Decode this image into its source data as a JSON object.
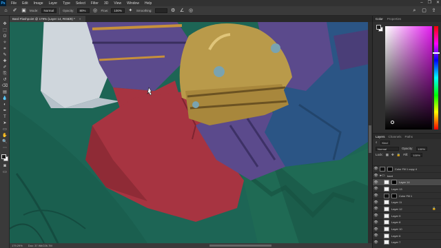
{
  "menubar": {
    "logo": "Ps",
    "items": [
      "File",
      "Edit",
      "Image",
      "Layer",
      "Type",
      "Select",
      "Filter",
      "3D",
      "View",
      "Window",
      "Help"
    ],
    "window_controls": [
      "–",
      "❐",
      "✕"
    ]
  },
  "options": {
    "mode_label": "Mode:",
    "mode_value": "Normal",
    "opacity_label": "Opacity:",
    "opacity_value": "80%",
    "flow_label": "Flow:",
    "flow_value": "100%",
    "smoothing_label": "Smoothing:",
    "smoothing_value": ""
  },
  "document": {
    "tab_title": "Bard Flashpoint @ 179% (Layer 14, RGB/8) *",
    "close_glyph": "×"
  },
  "status": {
    "zoom": "179.29%",
    "doc_size": "Doc: 37.9M/226.7M"
  },
  "color_panel": {
    "tabs": [
      "Color",
      "Properties"
    ]
  },
  "layers_panel": {
    "tabs": [
      "Layers",
      "Channels",
      "Paths"
    ],
    "filter_label": "Kind",
    "blend_mode": "Normal",
    "opacity_label": "Opacity:",
    "opacity_value": "100%",
    "lock_label": "Lock:",
    "fill_label": "Fill:",
    "fill_value": "100%",
    "layers": [
      {
        "name": "Color Fill 1 copy 4",
        "thumb": "dark",
        "mask": true,
        "selected": false,
        "indent": false,
        "folder": false,
        "locked": false
      },
      {
        "name": "bard",
        "thumb": "folder",
        "mask": false,
        "selected": false,
        "indent": false,
        "folder": true,
        "locked": false
      },
      {
        "name": "Layer 14",
        "thumb": "light",
        "mask": true,
        "selected": true,
        "indent": true,
        "folder": false,
        "locked": false
      },
      {
        "name": "Layer 13",
        "thumb": "light",
        "mask": false,
        "selected": false,
        "indent": true,
        "folder": false,
        "locked": false
      },
      {
        "name": "Color Fill 1",
        "thumb": "dark",
        "mask": true,
        "selected": false,
        "indent": true,
        "folder": false,
        "locked": false
      },
      {
        "name": "Layer 11",
        "thumb": "light",
        "mask": false,
        "selected": false,
        "indent": true,
        "folder": false,
        "locked": false
      },
      {
        "name": "Layer 12",
        "thumb": "light",
        "mask": false,
        "selected": false,
        "indent": true,
        "folder": false,
        "locked": true
      },
      {
        "name": "Layer 9",
        "thumb": "light",
        "mask": false,
        "selected": false,
        "indent": true,
        "folder": false,
        "locked": false
      },
      {
        "name": "Layer 8",
        "thumb": "light",
        "mask": false,
        "selected": false,
        "indent": true,
        "folder": false,
        "locked": false
      },
      {
        "name": "Layer 10",
        "thumb": "light",
        "mask": false,
        "selected": false,
        "indent": true,
        "folder": false,
        "locked": false
      },
      {
        "name": "Layer 6",
        "thumb": "light",
        "mask": false,
        "selected": false,
        "indent": true,
        "folder": false,
        "locked": false
      },
      {
        "name": "Layer 7",
        "thumb": "light",
        "mask": false,
        "selected": false,
        "indent": true,
        "folder": false,
        "locked": false
      }
    ]
  },
  "tools": [
    "move-tool",
    "marquee-tool",
    "lasso-tool",
    "quick-select-tool",
    "crop-tool",
    "eyedropper-tool",
    "healing-tool",
    "brush-tool",
    "clone-stamp-tool",
    "history-brush-tool",
    "eraser-tool",
    "gradient-tool",
    "blur-tool",
    "dodge-tool",
    "pen-tool",
    "type-tool",
    "path-select-tool",
    "shape-tool",
    "hand-tool",
    "zoom-tool",
    "more-tools"
  ],
  "tool_glyphs": [
    "✥",
    "⬚",
    "ʘ",
    "✧",
    "⌗",
    "✎",
    "✚",
    "✐",
    "⎘",
    "↺",
    "⌫",
    "▤",
    "💧",
    "◐",
    "✒",
    "T",
    "➤",
    "▭",
    "✋",
    "🔍",
    "⋯"
  ],
  "colors": {
    "canvas_bg": "#1d6555",
    "red_cloth": "#a73441",
    "purple": "#5b4a8c",
    "blue": "#2b5585",
    "bell_gold": "#b99a4a",
    "white_cloth": "#cfd6dc"
  }
}
